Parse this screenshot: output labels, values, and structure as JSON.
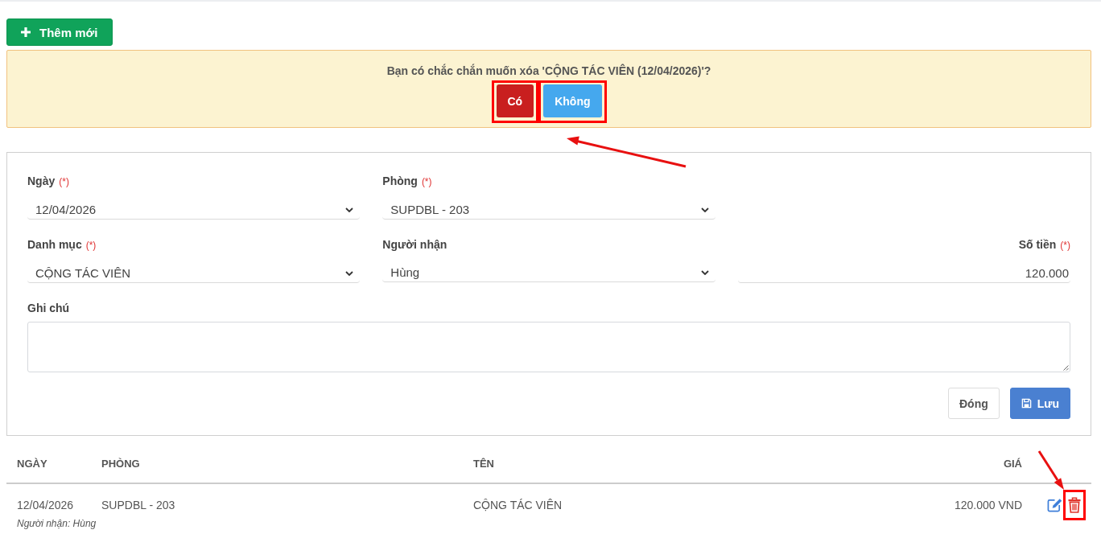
{
  "top_bar": {
    "add_button": "Thêm mới"
  },
  "confirm_alert": {
    "message": "Bạn có chắc chắn muốn xóa 'CỘNG TÁC VIÊN (12/04/2026)'?",
    "buttons": [
      {
        "label": "Có",
        "kind": "danger",
        "highlighted": true
      },
      {
        "label": "Không",
        "kind": "info",
        "highlighted": true
      }
    ],
    "arrow": true
  },
  "form": {
    "rows": [
      [
        {
          "label": "Ngày",
          "required_mark": "(*)",
          "kind": "select",
          "value": "12/04/2026"
        },
        {
          "label": "Phòng",
          "required_mark": "(*)",
          "kind": "select",
          "value": "SUPDBL - 203"
        }
      ],
      [
        {
          "label": "Danh mục",
          "required_mark": "(*)",
          "kind": "select",
          "value": "CỘNG TÁC VIÊN"
        },
        {
          "label": "Người nhận",
          "kind": "select",
          "value": "Hùng"
        },
        {
          "label": "Số tiền",
          "required_mark": "(*)",
          "kind": "number",
          "value": "120.000"
        }
      ],
      [
        {
          "label": "Ghi chú",
          "kind": "textarea"
        }
      ]
    ],
    "buttons": [
      {
        "label": "Đóng",
        "kind": "default"
      },
      {
        "label": "Lưu",
        "kind": "primary"
      }
    ]
  },
  "table": {
    "columns": [
      "NGÀY",
      "PHÒNG",
      "TÊN",
      "GIÁ"
    ],
    "rows": [
      {
        "cells": [
          "12/04/2026",
          "SUPDBL - 203",
          "CỘNG TÁC VIÊN",
          "120.000 VND"
        ],
        "note": "Người nhận: Hùng",
        "actions": [
          {
            "kind": "edit",
            "highlighted": false
          },
          {
            "kind": "delete",
            "highlighted": true,
            "arrow": true
          }
        ]
      }
    ]
  }
}
